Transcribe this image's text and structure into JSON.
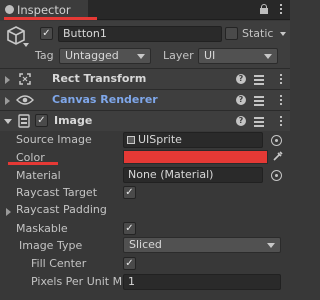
{
  "window": {
    "tab_label": "Inspector"
  },
  "gameobject": {
    "active": true,
    "name": "Button1",
    "static_label": "Static",
    "static_checked": false,
    "tag_label": "Tag",
    "tag_value": "Untagged",
    "layer_label": "Layer",
    "layer_value": "UI"
  },
  "components": {
    "rect_transform": {
      "title": "Rect Transform"
    },
    "canvas_renderer": {
      "title": "Canvas Renderer"
    },
    "image": {
      "title": "Image",
      "enabled": true,
      "properties": {
        "source_image_label": "Source Image",
        "source_image_value": "UISprite",
        "color_label": "Color",
        "color_value": "#e53935",
        "material_label": "Material",
        "material_value": "None (Material)",
        "raycast_target_label": "Raycast Target",
        "raycast_target_checked": true,
        "raycast_padding_label": "Raycast Padding",
        "maskable_label": "Maskable",
        "maskable_checked": true,
        "image_type_label": "Image Type",
        "image_type_value": "Sliced",
        "fill_center_label": "Fill Center",
        "fill_center_checked": true,
        "ppu_label": "Pixels Per Unit Mul",
        "ppu_value": "1"
      }
    }
  },
  "icons": {
    "check_glyph": "✓",
    "help_glyph": "?"
  },
  "colors": {
    "highlight_red": "#e53935",
    "panel_bg": "#383838",
    "header_bg": "#3e3e3e"
  }
}
